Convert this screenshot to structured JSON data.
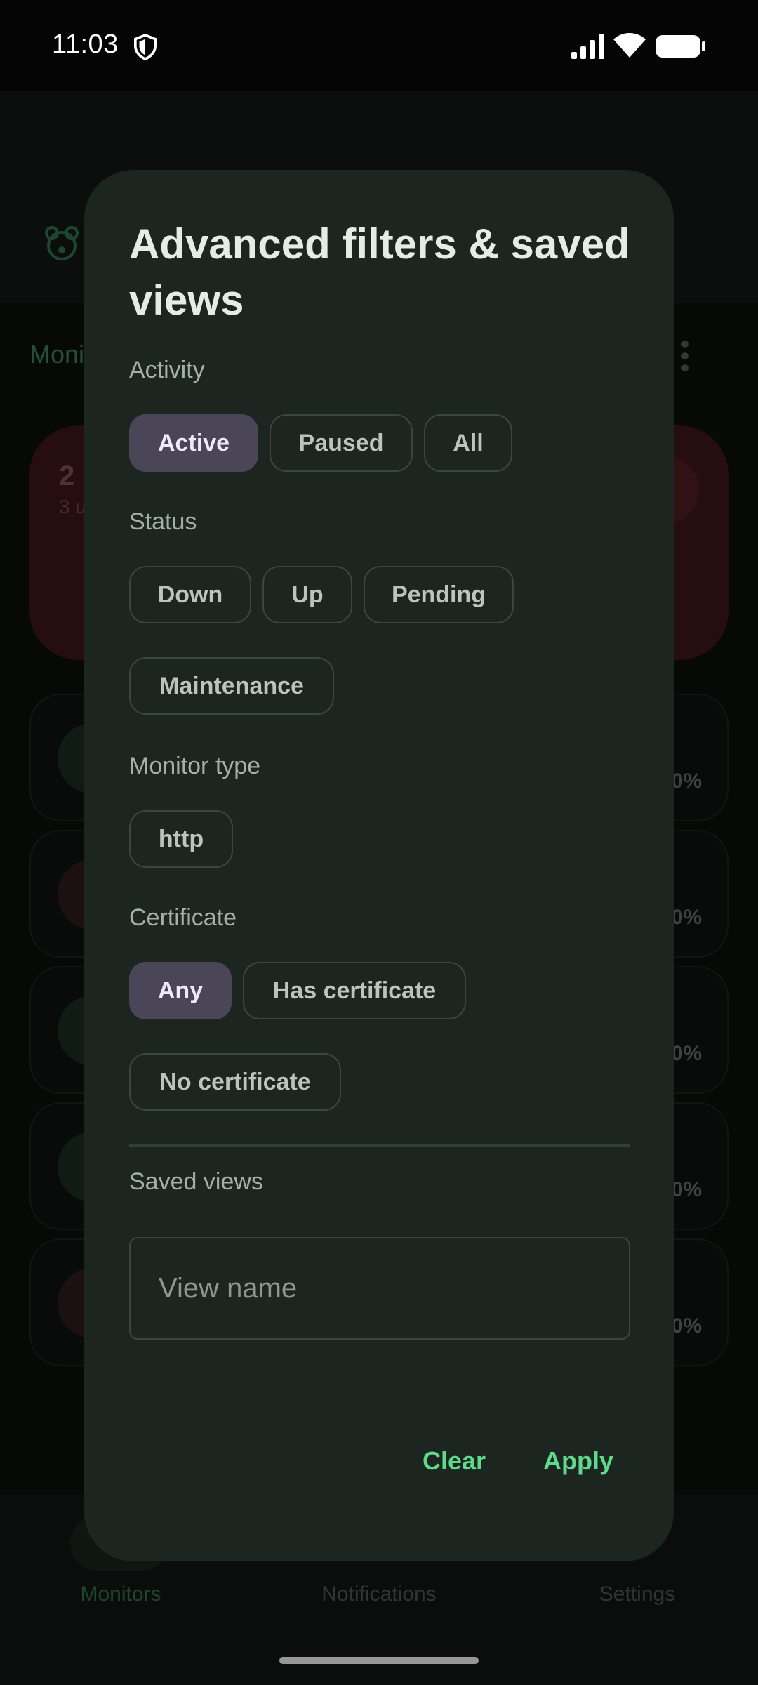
{
  "status_bar": {
    "time": "11:03"
  },
  "background": {
    "tab_label": "Moni",
    "summary_count": "2",
    "summary_sub": "3 u",
    "monitor_rows": [
      {
        "uptime": "0%",
        "status_color": "#1f3a2b"
      },
      {
        "uptime": "0%",
        "status_color": "#3a1c1f"
      },
      {
        "uptime": "0%",
        "status_color": "#1f3a2b"
      },
      {
        "uptime": "0%",
        "status_color": "#1f3a2b"
      },
      {
        "uptime": "0%",
        "status_color": "#3a1c1f"
      }
    ],
    "nav": {
      "monitors": "Monitors",
      "notifications": "Notifications",
      "settings": "Settings"
    }
  },
  "dialog": {
    "title": "Advanced filters & saved views",
    "activity": {
      "label": "Activity",
      "options": [
        "Active",
        "Paused",
        "All"
      ],
      "selected": "Active"
    },
    "status": {
      "label": "Status",
      "options": [
        "Down",
        "Up",
        "Pending",
        "Maintenance"
      ]
    },
    "monitor_type": {
      "label": "Monitor type",
      "options": [
        "http"
      ]
    },
    "certificate": {
      "label": "Certificate",
      "options": [
        "Any",
        "Has certificate",
        "No certificate"
      ],
      "selected": "Any"
    },
    "saved_views": {
      "label": "Saved views",
      "input_placeholder": "View name",
      "input_value": ""
    },
    "actions": {
      "clear": "Clear",
      "apply": "Apply"
    }
  },
  "colors": {
    "accent": "#5fd98a",
    "selected_chip": "#4a4658",
    "dialog_bg": "#1c2520"
  }
}
